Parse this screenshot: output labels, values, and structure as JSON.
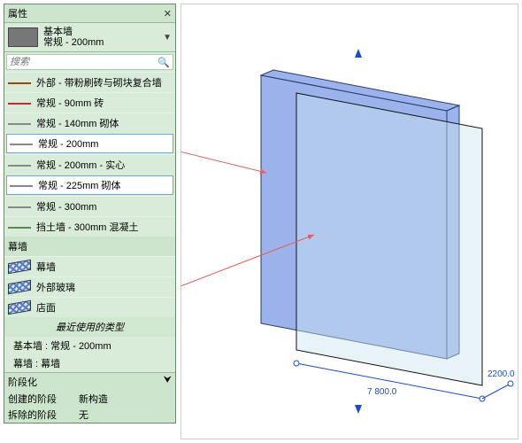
{
  "panel": {
    "title": "属性",
    "type_name": "基本墙",
    "type_sub": "常规 - 200mm",
    "search_placeholder": "搜索",
    "categories": {
      "basic_wall_items": [
        {
          "label": "外部 - 带粉刷砖与砌块复合墙",
          "swatch": "brown"
        },
        {
          "label": "常规 - 90mm 砖",
          "swatch": "red"
        },
        {
          "label": "常规 - 140mm 砌体",
          "swatch": "gray"
        },
        {
          "label": "常规 - 200mm",
          "swatch": "gray",
          "selected": true
        },
        {
          "label": "常规 - 200mm - 实心",
          "swatch": "gray"
        },
        {
          "label": "常规 - 225mm 砌体",
          "swatch": "gray",
          "hover": true
        },
        {
          "label": "常规 - 300mm",
          "swatch": "gray"
        },
        {
          "label": "挡土墙 - 300mm 混凝土",
          "swatch": "green"
        }
      ],
      "curtain_header": "幕墙",
      "curtain_items": [
        {
          "label": "幕墙"
        },
        {
          "label": "外部玻璃"
        },
        {
          "label": "店面"
        }
      ]
    },
    "recent_header": "最近使用的类型",
    "recent": [
      "基本墙 : 常规 - 200mm",
      "幕墙 : 幕墙"
    ],
    "phase": {
      "header": "阶段化",
      "r1k": "创建的阶段",
      "r1v": "新构造",
      "r2k": "拆除的阶段",
      "r2v": "无"
    }
  },
  "scene": {
    "dim1": "7 800.0",
    "dim2": "2200.0"
  }
}
